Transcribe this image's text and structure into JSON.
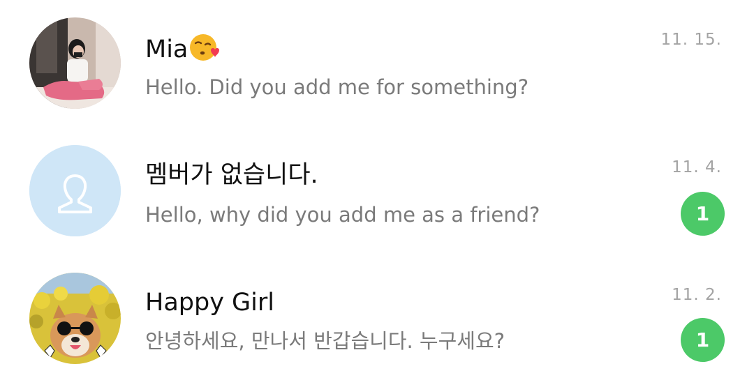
{
  "chats": [
    {
      "name": "Mia",
      "name_emoji": "kissing-face-emoji",
      "preview": "Hello. Did you add me for something?",
      "time": "11. 15.",
      "unread": null,
      "avatar": "photo-girl-avatar"
    },
    {
      "name": "멤버가 없습니다.",
      "preview": "Hello, why did you add me as a friend?",
      "time": "11. 4.",
      "unread": "1",
      "avatar": "default-person-icon"
    },
    {
      "name": "Happy Girl",
      "preview": "안녕하세요, 만나서 반갑습니다. 누구세요?",
      "time": "11. 2.",
      "unread": "1",
      "avatar": "dog-sunglasses-avatar"
    }
  ],
  "colors": {
    "unread_badge": "#4cc968",
    "default_avatar_bg": "#cfe6f7",
    "preview_text": "#7a7a7a",
    "time_text": "#a3a3a3"
  }
}
